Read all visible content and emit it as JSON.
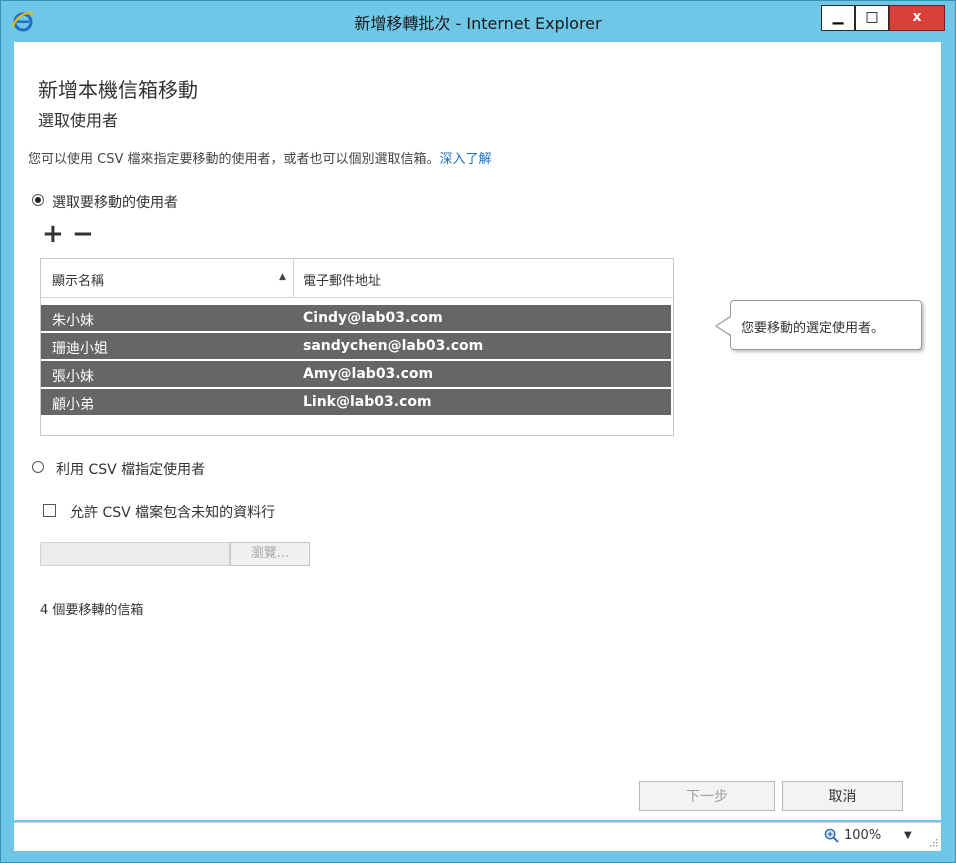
{
  "window": {
    "title": "新增移轉批次 - Internet Explorer",
    "controls": {
      "minimize": "▁",
      "maximize": "□",
      "close": "x"
    }
  },
  "page": {
    "heading": "新增本機信箱移動",
    "subheading": "選取使用者",
    "description": "您可以使用 CSV 檔來指定要移動的使用者，或者也可以個別選取信箱。",
    "learn_more": "深入了解"
  },
  "select_users": {
    "radio_label": "選取要移動的使用者",
    "selected": true,
    "add_icon": "+",
    "remove_icon": "−",
    "table": {
      "columns": [
        "顯示名稱",
        "電子郵件地址"
      ],
      "sort_indicator": "▲",
      "rows": [
        {
          "name": "朱小妹",
          "email": "Cindy@lab03.com"
        },
        {
          "name": "珊迪小姐",
          "email": "sandychen@lab03.com"
        },
        {
          "name": "張小妹",
          "email": "Amy@lab03.com"
        },
        {
          "name": "顧小弟",
          "email": "Link@lab03.com"
        }
      ]
    },
    "callout": "您要移動的選定使用者。"
  },
  "csv": {
    "radio_label": "利用 CSV 檔指定使用者",
    "selected": false,
    "checkbox_label": "允許 CSV 檔案包含未知的資料行",
    "checked": false,
    "browse_label": "瀏覽..."
  },
  "summary": {
    "count_text": "4 個要移轉的信箱"
  },
  "footer": {
    "next_label": "下一步",
    "cancel_label": "取消"
  },
  "statusbar": {
    "zoom": "100%",
    "zoom_dropdown": "▼"
  },
  "colors": {
    "frame": "#6ec7e6",
    "selected_row": "#666666",
    "link": "#1a6fc9",
    "close_button": "#d9403a"
  }
}
